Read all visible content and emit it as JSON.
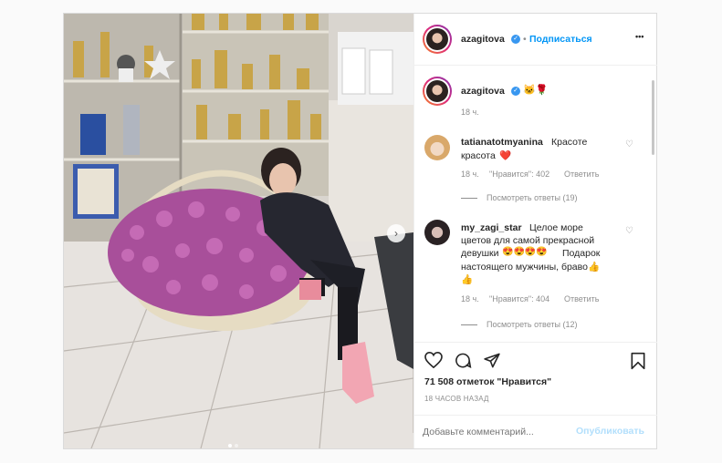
{
  "post": {
    "username": "azagitova",
    "follow_label": "Подписаться",
    "more_label": "•••",
    "caption": {
      "username": "azagitova",
      "emoji": "🐱🌹",
      "time": "18 ч."
    },
    "comments": [
      {
        "username": "tatianatotmyanina",
        "text_line1": "Красоте",
        "text_line2": "красота",
        "emoji": "❤️",
        "time": "18 ч.",
        "likes": "\"Нравится\": 402",
        "reply": "Ответить",
        "view_replies": "Посмотреть ответы (19)"
      },
      {
        "username": "my_zagi_star",
        "text_line1": "Целое море",
        "text_line2": "цветов для самой прекрасной",
        "text_line3": "девушки",
        "text_line3b": "Подарок",
        "text_line4": "настоящего мужчины, браво👍",
        "text_line5": "👍",
        "emoji_faces": "😍😍😍😍",
        "time": "18 ч.",
        "likes": "\"Нравится\": 404",
        "reply": "Ответить",
        "view_replies": "Посмотреть ответы (12)"
      }
    ],
    "likes_count": "71 508 отметок \"Нравится\"",
    "timestamp": "18 ЧАСОВ НАЗАД",
    "comment_placeholder": "Добавьте комментарий...",
    "publish_label": "Опубликовать"
  }
}
